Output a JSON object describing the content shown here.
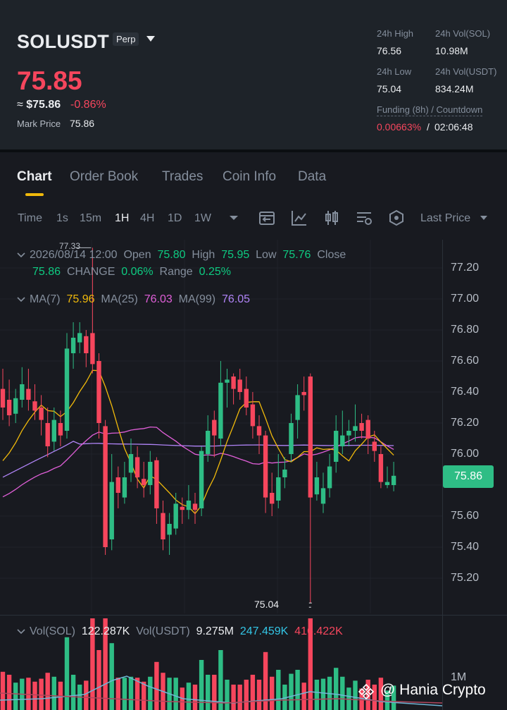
{
  "header": {
    "symbol": "SOLUSDT",
    "contract_type": "Perp",
    "last_price": "75.85",
    "approx_prefix": "≈",
    "approx_usd": "$75.86",
    "change_pct": "-0.86%",
    "mark_price_label": "Mark Price",
    "mark_price": "75.86",
    "stats": {
      "high_label": "24h High",
      "high": "76.56",
      "vol_sol_label": "24h Vol(SOL)",
      "vol_sol": "10.98M",
      "low_label": "24h Low",
      "low": "75.04",
      "vol_usdt_label": "24h Vol(USDT)",
      "vol_usdt": "834.24M",
      "funding_label": "Funding (8h) / Countdown",
      "funding_rate": "0.00663%",
      "funding_sep": "/",
      "countdown": "02:06:48"
    },
    "colors": {
      "down": "#f6465d",
      "up": "#0ecb81"
    }
  },
  "tabs": [
    "Chart",
    "Order Book",
    "Trades",
    "Coin Info",
    "Data"
  ],
  "toolbar": {
    "intervals": [
      "Time",
      "1s",
      "15m",
      "1H",
      "4H",
      "1D",
      "1W"
    ],
    "active_interval": "1H",
    "icons": [
      "chevron-down-icon",
      "indicator-settings-icon",
      "drawing-tools-icon",
      "chart-type-icon",
      "chart-settings-icon",
      "hexagon-icon"
    ],
    "price_type": "Last Price"
  },
  "candle_info": {
    "datetime": "2026/08/14 12:00",
    "open_label": "Open",
    "open": "75.80",
    "high_label": "High",
    "high": "75.95",
    "low_label": "Low",
    "low": "75.76",
    "close_label": "Close",
    "close": "75.86",
    "change_label": "CHANGE",
    "change": "0.06%",
    "range_label": "Range",
    "range": "0.25%"
  },
  "ma": {
    "ma7_label": "MA(7)",
    "ma7": "75.96",
    "ma25_label": "MA(25)",
    "ma25": "76.03",
    "ma99_label": "MA(99)",
    "ma99": "76.05",
    "colors": {
      "ma7": "#f0b90b",
      "ma25": "#e05fd8",
      "ma99": "#b084f7"
    }
  },
  "price_axis": [
    "77.20",
    "77.00",
    "76.80",
    "76.60",
    "76.40",
    "76.20",
    "76.00",
    "75.60",
    "75.40",
    "75.20"
  ],
  "current_price_tag": "75.86",
  "high_marker": "77.33",
  "low_marker": "75.04",
  "volume": {
    "label": "Vol(SOL)",
    "value": "122.287K",
    "usdt_label": "Vol(USDT)",
    "usdt": "9.275M",
    "ma1": "247.459K",
    "ma2": "416.422K",
    "axis_label": "1M"
  },
  "watermark": "@ Hania Crypto",
  "chart_data": {
    "type": "candlestick",
    "interval": "1H",
    "ylim": [
      75.0,
      77.35
    ],
    "candles": [
      [
        76.42,
        76.3,
        76.55,
        76.22
      ],
      [
        76.35,
        76.25,
        76.48,
        76.18
      ],
      [
        76.26,
        76.36,
        76.42,
        76.2
      ],
      [
        76.35,
        76.45,
        76.56,
        76.3
      ],
      [
        76.42,
        76.35,
        76.55,
        76.28
      ],
      [
        76.34,
        76.28,
        76.45,
        76.22
      ],
      [
        76.3,
        76.22,
        76.38,
        76.12
      ],
      [
        76.2,
        76.05,
        76.3,
        75.98
      ],
      [
        76.08,
        76.22,
        76.3,
        76.02
      ],
      [
        76.2,
        76.12,
        76.28,
        76.05
      ],
      [
        76.15,
        76.68,
        76.78,
        76.1
      ],
      [
        76.65,
        76.75,
        76.85,
        76.55
      ],
      [
        76.72,
        76.78,
        76.85,
        76.65
      ],
      [
        76.76,
        76.65,
        76.8,
        76.56
      ],
      [
        76.78,
        76.58,
        77.33,
        76.52
      ],
      [
        76.6,
        76.2,
        76.65,
        76.1
      ],
      [
        76.18,
        75.4,
        76.22,
        75.35
      ],
      [
        75.45,
        75.82,
        76.0,
        75.38
      ],
      [
        75.85,
        75.75,
        75.92,
        75.65
      ],
      [
        75.72,
        75.85,
        75.95,
        75.68
      ],
      [
        75.88,
        76.0,
        76.1,
        75.82
      ],
      [
        75.98,
        75.85,
        76.05,
        75.78
      ],
      [
        75.84,
        75.8,
        75.95,
        75.72
      ],
      [
        75.8,
        75.95,
        76.02,
        75.74
      ],
      [
        75.96,
        75.65,
        75.98,
        75.55
      ],
      [
        75.62,
        75.45,
        75.7,
        75.38
      ],
      [
        75.48,
        75.55,
        75.62,
        75.35
      ],
      [
        75.52,
        75.68,
        75.75,
        75.48
      ],
      [
        75.66,
        75.64,
        75.72,
        75.55
      ],
      [
        75.64,
        75.7,
        75.8,
        75.58
      ],
      [
        75.68,
        75.64,
        75.75,
        75.55
      ],
      [
        75.65,
        76.02,
        76.05,
        75.6
      ],
      [
        76.0,
        76.15,
        76.25,
        75.95
      ],
      [
        76.22,
        76.12,
        76.28,
        75.98
      ],
      [
        76.1,
        76.46,
        76.6,
        76.05
      ],
      [
        76.46,
        76.48,
        76.55,
        76.3
      ],
      [
        76.5,
        76.42,
        76.52,
        76.32
      ],
      [
        76.48,
        76.4,
        76.55,
        76.35
      ],
      [
        76.42,
        76.3,
        76.5,
        76.25
      ],
      [
        76.32,
        76.18,
        76.4,
        76.1
      ],
      [
        76.18,
        76.12,
        76.25,
        76.0
      ],
      [
        76.12,
        75.72,
        76.15,
        75.62
      ],
      [
        75.75,
        75.68,
        75.88,
        75.6
      ],
      [
        75.7,
        75.85,
        76.0,
        75.65
      ],
      [
        75.85,
        75.9,
        75.98,
        75.78
      ],
      [
        76.0,
        76.2,
        76.26,
        75.95
      ],
      [
        76.22,
        76.38,
        76.45,
        76.1
      ],
      [
        76.4,
        76.38,
        76.5,
        76.28
      ],
      [
        76.5,
        75.72,
        76.52,
        75.04
      ],
      [
        75.74,
        75.85,
        75.95,
        75.7
      ],
      [
        75.68,
        75.78,
        75.88,
        75.62
      ],
      [
        75.78,
        75.92,
        76.0,
        75.72
      ],
      [
        75.95,
        76.15,
        76.25,
        75.88
      ],
      [
        76.05,
        76.12,
        76.28,
        76.0
      ],
      [
        76.12,
        76.15,
        76.22,
        76.05
      ],
      [
        76.15,
        76.18,
        76.32,
        76.08
      ],
      [
        76.2,
        76.15,
        76.26,
        76.1
      ],
      [
        76.22,
        76.1,
        76.25,
        76.0
      ],
      [
        76.08,
        76.02,
        76.15,
        75.95
      ],
      [
        76.0,
        75.82,
        76.05,
        75.78
      ],
      [
        75.8,
        75.82,
        75.92,
        75.78
      ],
      [
        75.8,
        75.86,
        75.95,
        75.76
      ]
    ],
    "ma7_last": 75.96,
    "ma25_last": 76.03,
    "ma99_last": 76.05
  }
}
